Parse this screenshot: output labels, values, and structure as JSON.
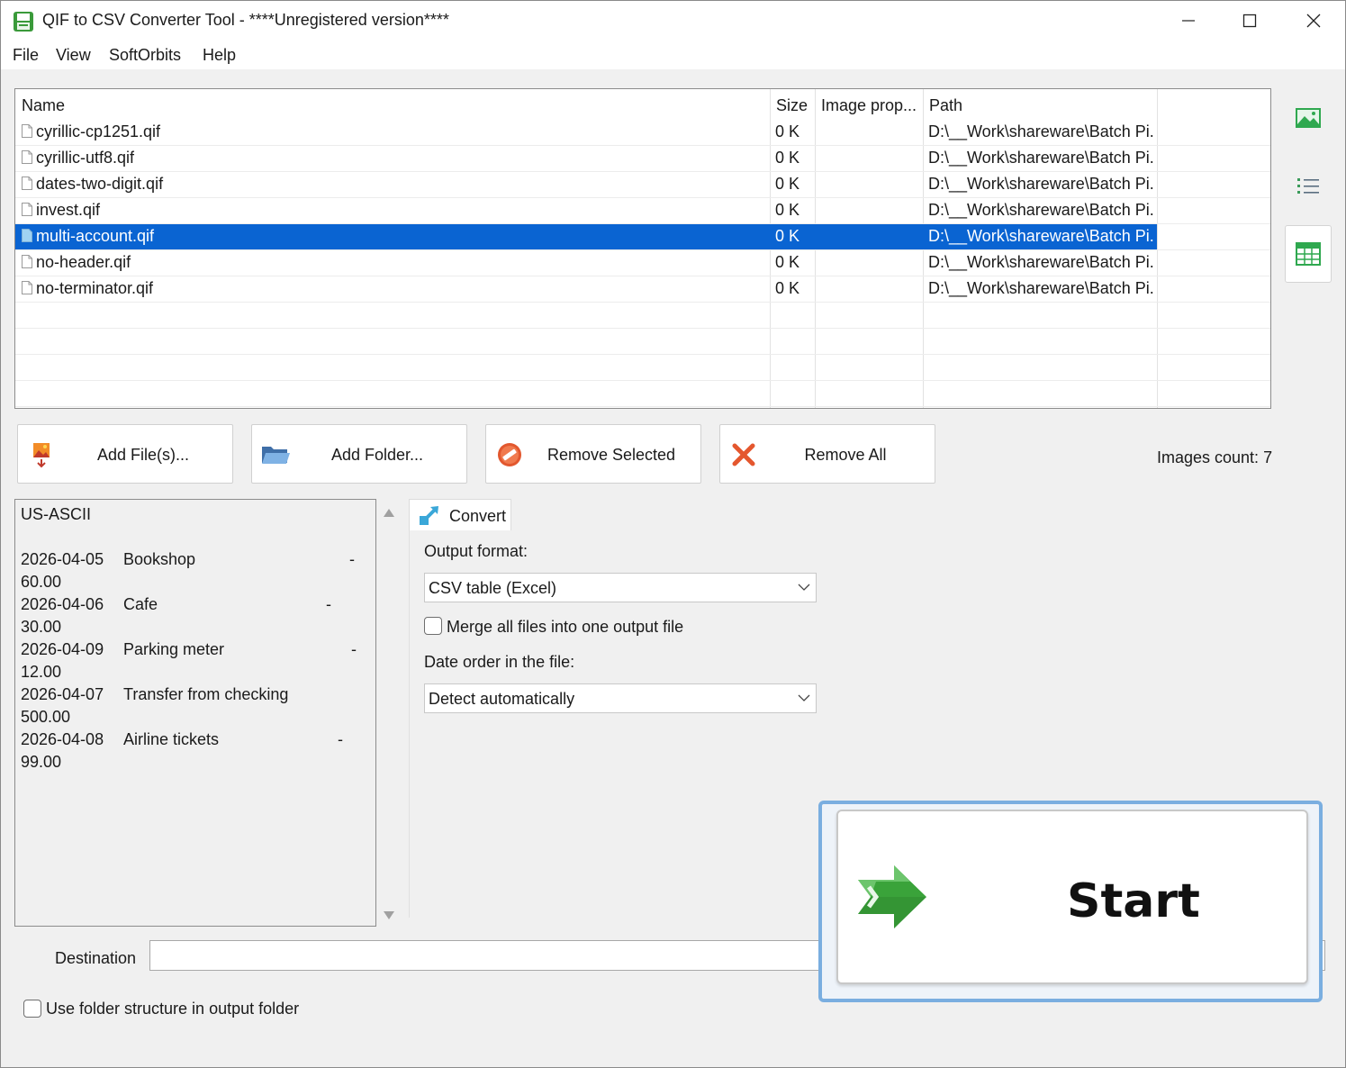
{
  "window": {
    "title": "QIF to CSV Converter Tool - ****Unregistered version****"
  },
  "menu": {
    "file": "File",
    "view": "View",
    "softorbits": "SoftOrbits",
    "help": "Help"
  },
  "file_list": {
    "columns": [
      "Name",
      "Size",
      "Image prop...",
      "Path"
    ],
    "rows": [
      {
        "name": "cyrillic-cp1251.qif",
        "size": "0 K",
        "props": "",
        "path": "D:\\__Work\\shareware\\Batch Pi..."
      },
      {
        "name": "cyrillic-utf8.qif",
        "size": "0 K",
        "props": "",
        "path": "D:\\__Work\\shareware\\Batch Pi..."
      },
      {
        "name": "dates-two-digit.qif",
        "size": "0 K",
        "props": "",
        "path": "D:\\__Work\\shareware\\Batch Pi..."
      },
      {
        "name": "invest.qif",
        "size": "0 K",
        "props": "",
        "path": "D:\\__Work\\shareware\\Batch Pi..."
      },
      {
        "name": "multi-account.qif",
        "size": "0 K",
        "props": "",
        "path": "D:\\__Work\\shareware\\Batch Pi...",
        "selected": true
      },
      {
        "name": "no-header.qif",
        "size": "0 K",
        "props": "",
        "path": "D:\\__Work\\shareware\\Batch Pi..."
      },
      {
        "name": "no-terminator.qif",
        "size": "0 K",
        "props": "",
        "path": "D:\\__Work\\shareware\\Batch Pi..."
      }
    ],
    "selected_color": "#0a64d2"
  },
  "side_toolbar": {
    "icons": [
      "image-view-icon",
      "list-view-icon",
      "table-view-icon"
    ],
    "active": "table-view-icon"
  },
  "actions": {
    "add_files": "Add File(s)...",
    "add_folder": "Add Folder...",
    "remove_selected": "Remove Selected",
    "remove_all": "Remove All",
    "images_count": "Images count: 7"
  },
  "preview": {
    "encoding": "US-ASCII",
    "entries": [
      {
        "date": "2026-04-05",
        "desc": "Bookshop",
        "dash": "-",
        "amount": "60.00"
      },
      {
        "date": "2026-04-06",
        "desc": "Cafe",
        "dash": "-",
        "amount": "30.00"
      },
      {
        "date": "2026-04-09",
        "desc": "Parking meter",
        "dash": "-",
        "amount": "12.00"
      },
      {
        "date": "2026-04-07",
        "desc": "Transfer from checking",
        "dash": "",
        "amount": "500.00"
      },
      {
        "date": "2026-04-08",
        "desc": "Airline tickets",
        "dash": "-",
        "amount": "99.00"
      }
    ]
  },
  "convert_tab": {
    "label": "Convert",
    "output_format_label": "Output format:",
    "output_format_value": "CSV table (Excel)",
    "merge_label": "Merge all files into one output file",
    "merge_checked": false,
    "date_order_label": "Date order in the file:",
    "date_order_value": "Detect automatically"
  },
  "destination": {
    "label": "Destination",
    "value": "",
    "use_folder_structure_label": "Use folder structure in output folder",
    "use_folder_structure_checked": false
  },
  "start": {
    "label": "Start",
    "accent": "#7aaee0"
  }
}
